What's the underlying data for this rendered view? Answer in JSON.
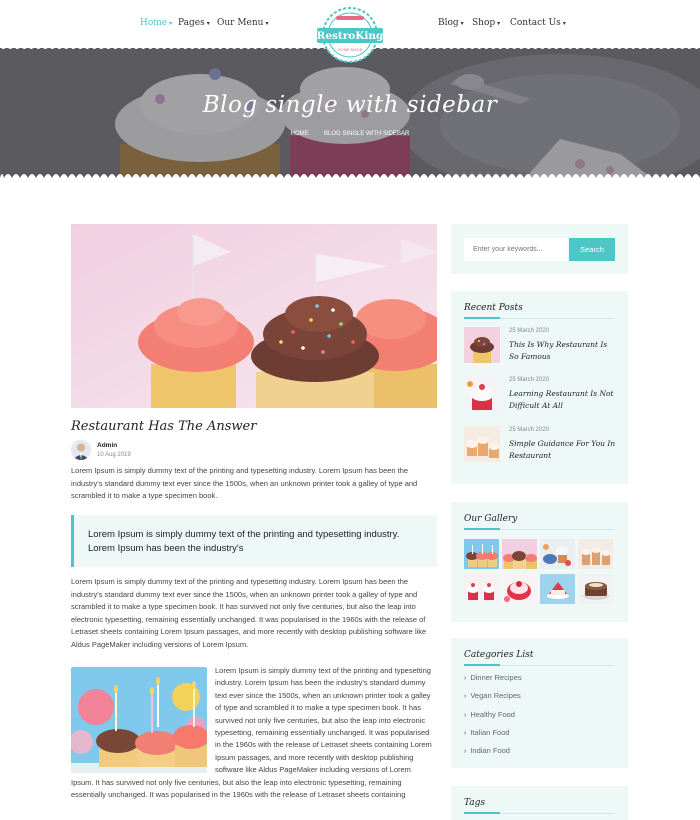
{
  "nav": {
    "items_left": [
      {
        "label": "Home",
        "active": true
      },
      {
        "label": "Pages",
        "active": false
      },
      {
        "label": "Our Menu",
        "active": false
      }
    ],
    "items_right": [
      {
        "label": "Blog",
        "active": false
      },
      {
        "label": "Shop",
        "active": false
      },
      {
        "label": "Contact Us",
        "active": false
      }
    ],
    "logo": {
      "name": "RestroKing",
      "tagline": "HOME MADE"
    }
  },
  "hero": {
    "title": "Blog single with sidebar",
    "breadcrumb": [
      "Home",
      "Blog Single with sidebar"
    ]
  },
  "post": {
    "title": "Restaurant Has The Answer",
    "author": "Admin",
    "date": "10 Aug 2019",
    "intro": "Lorem Ipsum is simply dummy text of the printing and typesetting industry. Lorem Ipsum has been the industry's standard dummy text ever since the 1500s, when an unknown printer took a galley of type and scrambled it to make a type specimen book.",
    "quote": "Lorem Ipsum is simply dummy text of the printing and typesetting industry. Lorem Ipsum has been the industry's",
    "body": "Lorem Ipsum is simply dummy text of the printing and typesetting industry. Lorem Ipsum has been the industry's standard dummy text ever since the 1500s, when an unknown printer took a galley of type and scrambled it to make a type specimen book. It has survived not only five centuries, but also the leap into electronic typesetting, remaining essentially unchanged. It was popularised in the 1960s with the release of Letraset sheets containing Lorem Ipsum passages, and more recently with desktop publishing software like Aldus PageMaker including versions of Lorem Ipsum.",
    "wrap": "Lorem Ipsum is simply dummy text of the printing and typesetting industry. Lorem Ipsum has been the industry's standard dummy text ever since the 1500s, when an unknown printer took a galley of type and scrambled it to make a type specimen book. It has survived not only five centuries, but also the leap into electronic typesetting, remaining essentially unchanged. It was popularised in the 1960s with the release of Letraset sheets containing Lorem Ipsum passages, and more recently with desktop publishing software like Aldus PageMaker including versions of Lorem",
    "tail": "Ipsum. It has survived not only five centuries, but also the leap into electronic typesetting, remaining essentially unchanged. It was popularised in the 1960s with the release of Letraset sheets containing"
  },
  "sidebar": {
    "search": {
      "placeholder": "Enter your keywords...",
      "button": "Search"
    },
    "recent": {
      "title": "Recent Posts",
      "items": [
        {
          "date": "25 March 2020",
          "title": "This Is Why Restaurant Is So Famous"
        },
        {
          "date": "25 March 2020",
          "title": "Learning Restaurant Is Not Difficult At All"
        },
        {
          "date": "25 March 2020",
          "title": "Simple Guidance For You In Restaurant"
        }
      ]
    },
    "gallery": {
      "title": "Our Gallery"
    },
    "categories": {
      "title": "Categories List",
      "items": [
        "Dinner Recipes",
        "Vegan Recipes",
        "Healthy Food",
        "Italian Food",
        "Indian Food"
      ]
    },
    "tags": {
      "title": "Tags"
    }
  },
  "colors": {
    "accent": "#4cc6c6",
    "panel": "#edf8f7",
    "logo_pink": "#e86a8a"
  }
}
